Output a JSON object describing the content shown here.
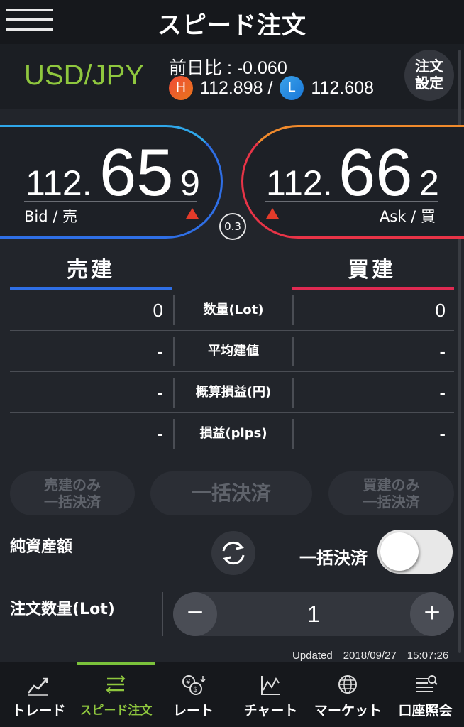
{
  "header": {
    "title": "スピード注文"
  },
  "pair": {
    "symbol": "USD/JPY",
    "change": "前日比 : -0.060",
    "high_badge": "H",
    "high": "112.898 /",
    "low_badge": "L",
    "low": "112.608",
    "settings_line1": "注文",
    "settings_line2": "設定"
  },
  "bid": {
    "prefix": "112.",
    "big": "65",
    "last": "9",
    "label": "Bid / 売"
  },
  "ask": {
    "prefix": "112.",
    "big": "66",
    "last": "2",
    "label": "Ask / 買"
  },
  "spread": "0.3",
  "sell_heading": "売建",
  "buy_heading": "買建",
  "positions": [
    {
      "label": "数量(Lot)",
      "sell": "0",
      "buy": "0"
    },
    {
      "label": "平均建値",
      "sell": "-",
      "buy": "-"
    },
    {
      "label": "概算損益(円)",
      "sell": "-",
      "buy": "-"
    },
    {
      "label": "損益(pips)",
      "sell": "-",
      "buy": "-"
    }
  ],
  "buttons": {
    "sell_close_1": "売建のみ",
    "sell_close_2": "一括決済",
    "close_all": "一括決済",
    "buy_close_1": "買建のみ",
    "buy_close_2": "一括決済"
  },
  "net_assets_label": "純資産額",
  "bulk_close_label": "一括決済",
  "bulk_close_enabled": false,
  "order_qty_label": "注文数量(Lot)",
  "order_qty": "1",
  "stepper": {
    "minus": "−",
    "plus": "+"
  },
  "updated": "Updated　2018/09/27　15:07:26",
  "tabs": [
    {
      "label": "トレード",
      "icon": "trend-chart-icon"
    },
    {
      "label": "スピード注文",
      "icon": "speed-order-icon",
      "active": true
    },
    {
      "label": "レート",
      "icon": "currency-rate-icon"
    },
    {
      "label": "チャート",
      "icon": "line-chart-icon"
    },
    {
      "label": "マーケット",
      "icon": "globe-icon"
    },
    {
      "label": "口座照会",
      "icon": "account-icon"
    }
  ],
  "colors": {
    "accent_green": "#8fc73e",
    "sell_blue": "#2f6fe6",
    "buy_red": "#e83447",
    "up_triangle": "#e33b2a"
  }
}
